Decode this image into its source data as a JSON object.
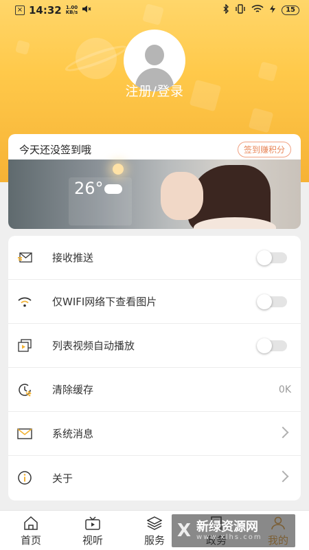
{
  "status_bar": {
    "time": "14:32",
    "speed": "1.00\nKB/s",
    "battery": "15"
  },
  "profile": {
    "login_label": "注册/登录"
  },
  "signin": {
    "prompt": "今天还没签到哦",
    "button": "签到赚积分",
    "banner_temperature": "26°"
  },
  "settings": {
    "items": [
      {
        "label": "接收推送",
        "icon": "envelope-send-icon",
        "control": "toggle"
      },
      {
        "label": "仅WIFI网络下查看图片",
        "icon": "wifi-icon",
        "control": "toggle"
      },
      {
        "label": "列表视频自动播放",
        "icon": "video-play-icon",
        "control": "toggle"
      },
      {
        "label": "清除缓存",
        "icon": "clock-clean-icon",
        "control": "value",
        "value": "0K"
      },
      {
        "label": "系统消息",
        "icon": "mail-icon",
        "control": "chevron"
      },
      {
        "label": "关于",
        "icon": "info-icon",
        "control": "chevron"
      }
    ]
  },
  "tabs": [
    {
      "label": "首页",
      "icon": "home-icon"
    },
    {
      "label": "视听",
      "icon": "tv-icon"
    },
    {
      "label": "服务",
      "icon": "layers-icon"
    },
    {
      "label": "政务",
      "icon": "document-icon"
    },
    {
      "label": "我的",
      "icon": "user-icon"
    }
  ],
  "watermark": {
    "title": "新绿资源网",
    "url": "www.xlhs.com"
  },
  "colors": {
    "header_start": "#ffd66a",
    "header_end": "#f6b235",
    "accent": "#e8875a",
    "icon_yellow": "#f2b233"
  }
}
